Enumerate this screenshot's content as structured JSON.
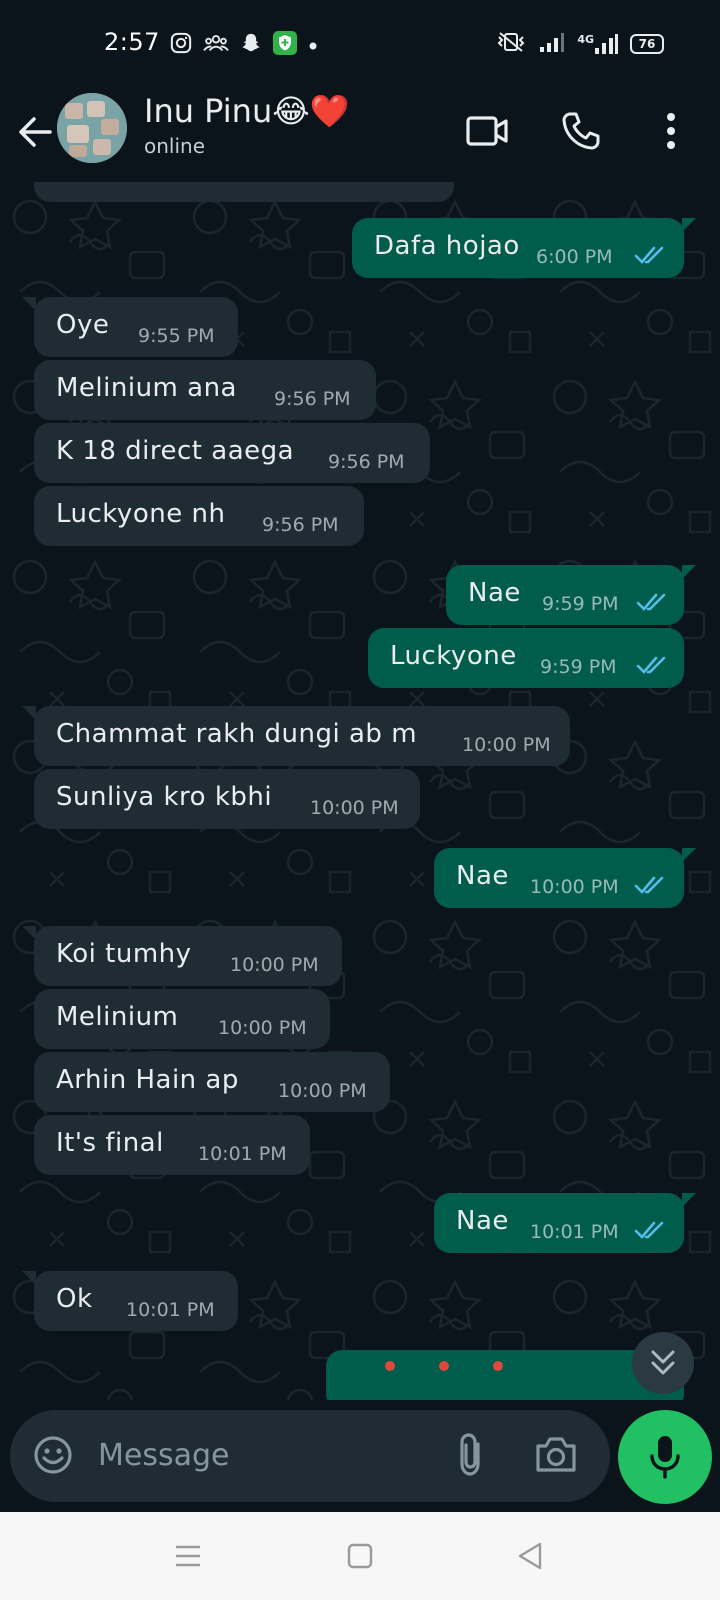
{
  "status_bar": {
    "time": "2:57",
    "network": "4G",
    "battery": "76"
  },
  "header": {
    "contact_name": "Inu Pinu😂❤️",
    "contact_status": "online"
  },
  "messages": [
    {
      "direction": "out",
      "text": "Dafa hojao",
      "time": "6:00 PM",
      "read": true
    },
    {
      "direction": "in",
      "text": "Oye",
      "time": "9:55 PM"
    },
    {
      "direction": "in",
      "text": "Melinium ana",
      "time": "9:56 PM"
    },
    {
      "direction": "in",
      "text": "K 18 direct aaega",
      "time": "9:56 PM"
    },
    {
      "direction": "in",
      "text": "Luckyone nh",
      "time": "9:56 PM"
    },
    {
      "direction": "out",
      "text": "Nae",
      "time": "9:59 PM",
      "read": true
    },
    {
      "direction": "out",
      "text": "Luckyone",
      "time": "9:59 PM",
      "read": true
    },
    {
      "direction": "in",
      "text": "Chammat rakh dungi ab m",
      "time": "10:00 PM"
    },
    {
      "direction": "in",
      "text": "Sunliya kro kbhi",
      "time": "10:00 PM"
    },
    {
      "direction": "out",
      "text": "Nae",
      "time": "10:00 PM",
      "read": true
    },
    {
      "direction": "in",
      "text": "Koi tumhy",
      "time": "10:00 PM"
    },
    {
      "direction": "in",
      "text": "Melinium",
      "time": "10:00 PM"
    },
    {
      "direction": "in",
      "text": "Arhin Hain ap",
      "time": "10:00 PM"
    },
    {
      "direction": "in",
      "text": "It's final",
      "time": "10:01 PM"
    },
    {
      "direction": "out",
      "text": "Nae",
      "time": "10:01 PM",
      "read": true
    },
    {
      "direction": "in",
      "text": "Ok",
      "time": "10:01 PM"
    }
  ],
  "composer": {
    "placeholder": "Message"
  },
  "colors": {
    "background": "#0b141a",
    "incoming_bubble": "#1f2c34",
    "outgoing_bubble": "#005c4b",
    "read_ticks": "#53bdeb",
    "mic_button": "#21c063"
  },
  "icons": {
    "back": "arrow-left-icon",
    "video": "video-call-icon",
    "voice": "phone-icon",
    "menu": "more-vertical-icon",
    "scroll": "double-chevron-down-icon",
    "emoji": "emoji-icon",
    "attach": "paperclip-icon",
    "camera": "camera-icon",
    "mic": "mic-icon"
  }
}
